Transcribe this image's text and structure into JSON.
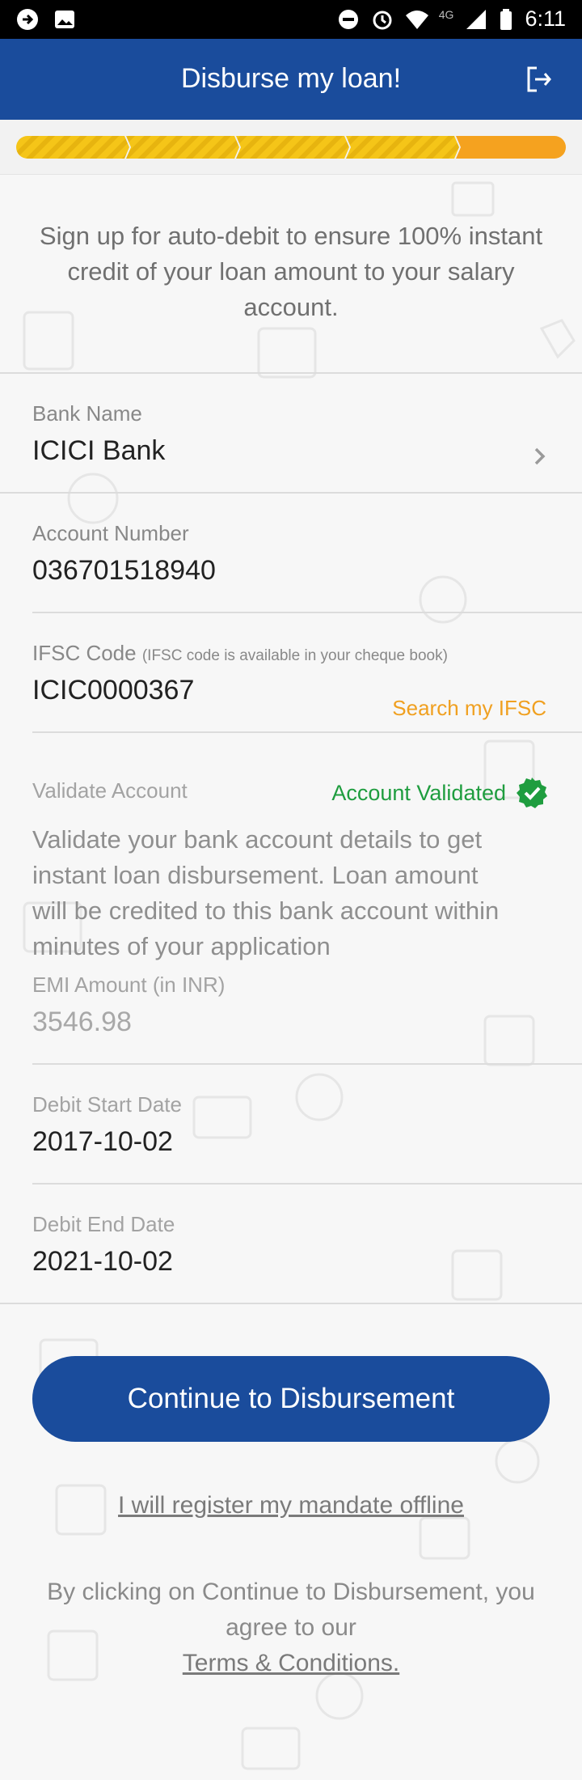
{
  "status_bar": {
    "network": "4G",
    "time": "6:11",
    "icons": [
      "app-notification-icon",
      "image-icon",
      "do-not-disturb-icon",
      "alarm-icon",
      "wifi-icon",
      "signal-icon",
      "battery-icon"
    ]
  },
  "header": {
    "title": "Disburse my loan!",
    "logout_icon": "logout-icon"
  },
  "progress": {
    "steps": 5,
    "current_step": 5,
    "colors": {
      "done": "#f5c518",
      "current": "#f5a21f"
    }
  },
  "intro_text": "Sign up for auto-debit to ensure 100% instant credit of your loan amount to your salary account.",
  "fields": {
    "bank_name": {
      "label": "Bank Name",
      "value": "ICICI Bank"
    },
    "account_number": {
      "label": "Account Number",
      "value": "036701518940"
    },
    "ifsc": {
      "label": "IFSC Code",
      "hint": "(IFSC code is available in your cheque book)",
      "value": "ICIC0000367",
      "search_label": "Search my IFSC"
    },
    "validate": {
      "label": "Validate Account",
      "status": "Account Validated",
      "description": "Validate your bank account details to get instant loan disbursement. Loan amount will be credited to this bank account within minutes of your application"
    },
    "emi": {
      "label": "EMI Amount (in INR)",
      "value": "3546.98"
    },
    "debit_start": {
      "label": "Debit Start Date",
      "value": "2017-10-02"
    },
    "debit_end": {
      "label": "Debit End Date",
      "value": "2021-10-02"
    }
  },
  "cta_label": "Continue to Disbursement",
  "offline_link": "I will register my mandate offline",
  "terms": {
    "prefix": "By clicking on Continue to Disbursement, you agree to our",
    "link": "Terms & Conditions."
  },
  "colors": {
    "primary": "#1a4c9c",
    "accent": "#f0a020",
    "success": "#1f9d3f"
  }
}
